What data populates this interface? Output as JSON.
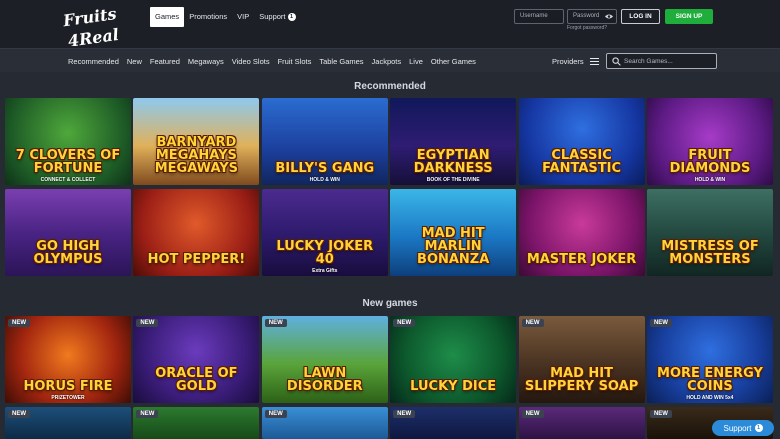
{
  "brand": {
    "logo_text": "Fruits 4 Real"
  },
  "main_nav": [
    {
      "label": "Games",
      "active": true
    },
    {
      "label": "Promotions"
    },
    {
      "label": "VIP"
    },
    {
      "label": "Support",
      "badge": "1"
    }
  ],
  "auth": {
    "username_placeholder": "Username",
    "password_placeholder": "Password",
    "forgot": "Forgot password?",
    "login": "LOG IN",
    "signup": "SIGN UP"
  },
  "categories": [
    "Recommended",
    "New",
    "Featured",
    "Megaways",
    "Video Slots",
    "Fruit Slots",
    "Table Games",
    "Jackpots",
    "Live",
    "Other Games"
  ],
  "providers_label": "Providers",
  "search_placeholder": "Search Games...",
  "sections": {
    "recommended": {
      "title": "Recommended",
      "games": [
        {
          "title": "7 Clovers of Fortune",
          "subtitle": "CONNECT & COLLECT"
        },
        {
          "title": "BarnYard Megahays Megaways",
          "subtitle": ""
        },
        {
          "title": "Billy's Gang",
          "subtitle": "HOLD & WIN"
        },
        {
          "title": "Egyptian Darkness",
          "subtitle": "BOOK OF THE DIVINE"
        },
        {
          "title": "Classic Fantastic",
          "subtitle": ""
        },
        {
          "title": "Fruit Diamonds",
          "subtitle": "HOLD & WIN"
        },
        {
          "title": "Go High Olympus",
          "subtitle": ""
        },
        {
          "title": "Hot Pepper!",
          "subtitle": ""
        },
        {
          "title": "Lucky Joker 40",
          "subtitle": "Extra Gifts"
        },
        {
          "title": "Mad Hit Marlin Bonanza",
          "subtitle": ""
        },
        {
          "title": "Master Joker",
          "subtitle": ""
        },
        {
          "title": "Mistress of Monsters",
          "subtitle": ""
        }
      ]
    },
    "new_games": {
      "title": "New games",
      "tag": "NEW",
      "games": [
        {
          "title": "Horus Fire",
          "subtitle": "PRIZETOWER"
        },
        {
          "title": "Oracle of Gold",
          "subtitle": ""
        },
        {
          "title": "Lawn Disorder",
          "subtitle": ""
        },
        {
          "title": "Lucky Dice",
          "subtitle": ""
        },
        {
          "title": "Mad Hit Slippery Soap",
          "subtitle": ""
        },
        {
          "title": "More Energy Coins",
          "subtitle": "HOLD AND WIN 5x4"
        }
      ]
    }
  },
  "support_label": "Support",
  "support_badge": "1"
}
